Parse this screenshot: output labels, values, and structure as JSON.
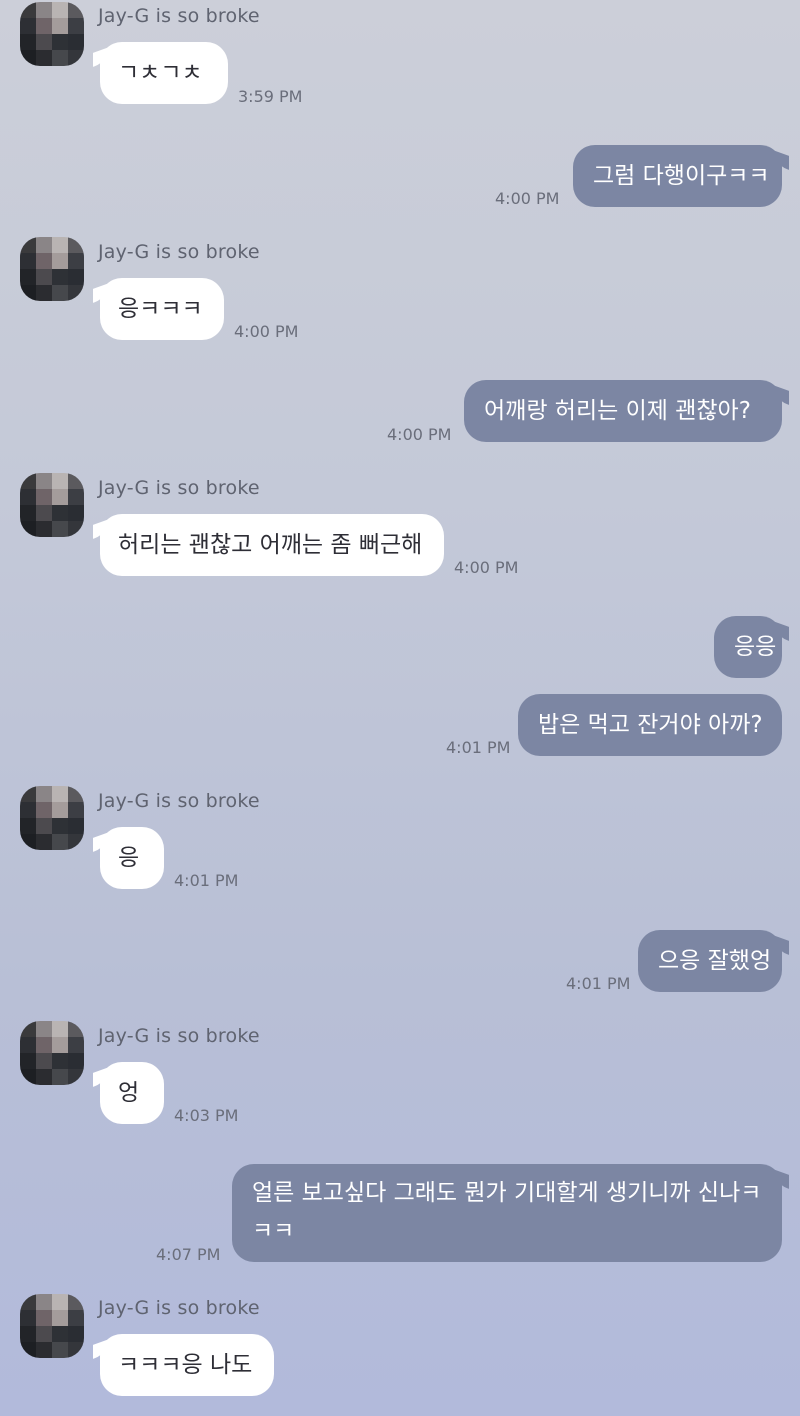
{
  "conversation": {
    "contact_name": "Jay-G is so broke",
    "messages": [
      {
        "from": "them",
        "text": "ㄱㅊㄱㅊ",
        "time": "3:59 PM"
      },
      {
        "from": "me",
        "text": "그럼 다행이구ㅋㅋ",
        "time": "4:00 PM"
      },
      {
        "from": "them",
        "text": "응ㅋㅋㅋ",
        "time": "4:00 PM"
      },
      {
        "from": "me",
        "text": "어깨랑 허리는 이제 괜찮아?",
        "time": "4:00 PM"
      },
      {
        "from": "them",
        "text": "허리는 괜찮고 어깨는 좀 뻐근해",
        "time": "4:00 PM"
      },
      {
        "from": "me",
        "text": "응응",
        "time": ""
      },
      {
        "from": "me",
        "text": "밥은 먹고 잔거야 아까?",
        "time": "4:01 PM"
      },
      {
        "from": "them",
        "text": "응",
        "time": "4:01 PM"
      },
      {
        "from": "me",
        "text": "으응 잘했엉",
        "time": "4:01 PM"
      },
      {
        "from": "them",
        "text": "엉",
        "time": "4:03 PM"
      },
      {
        "from": "me",
        "text": "얼른 보고싶다 그래도 뭔가 기대할게 생기니까 신나ㅋㅋㅋ",
        "time": "4:07 PM"
      },
      {
        "from": "them",
        "text": "ㅋㅋㅋ응 나도",
        "time": ""
      }
    ]
  },
  "colors": {
    "incoming_bubble": "#ffffff",
    "outgoing_bubble": "#7c86a3",
    "background_top": "#cccfd9",
    "background_bottom": "#b2badb"
  }
}
